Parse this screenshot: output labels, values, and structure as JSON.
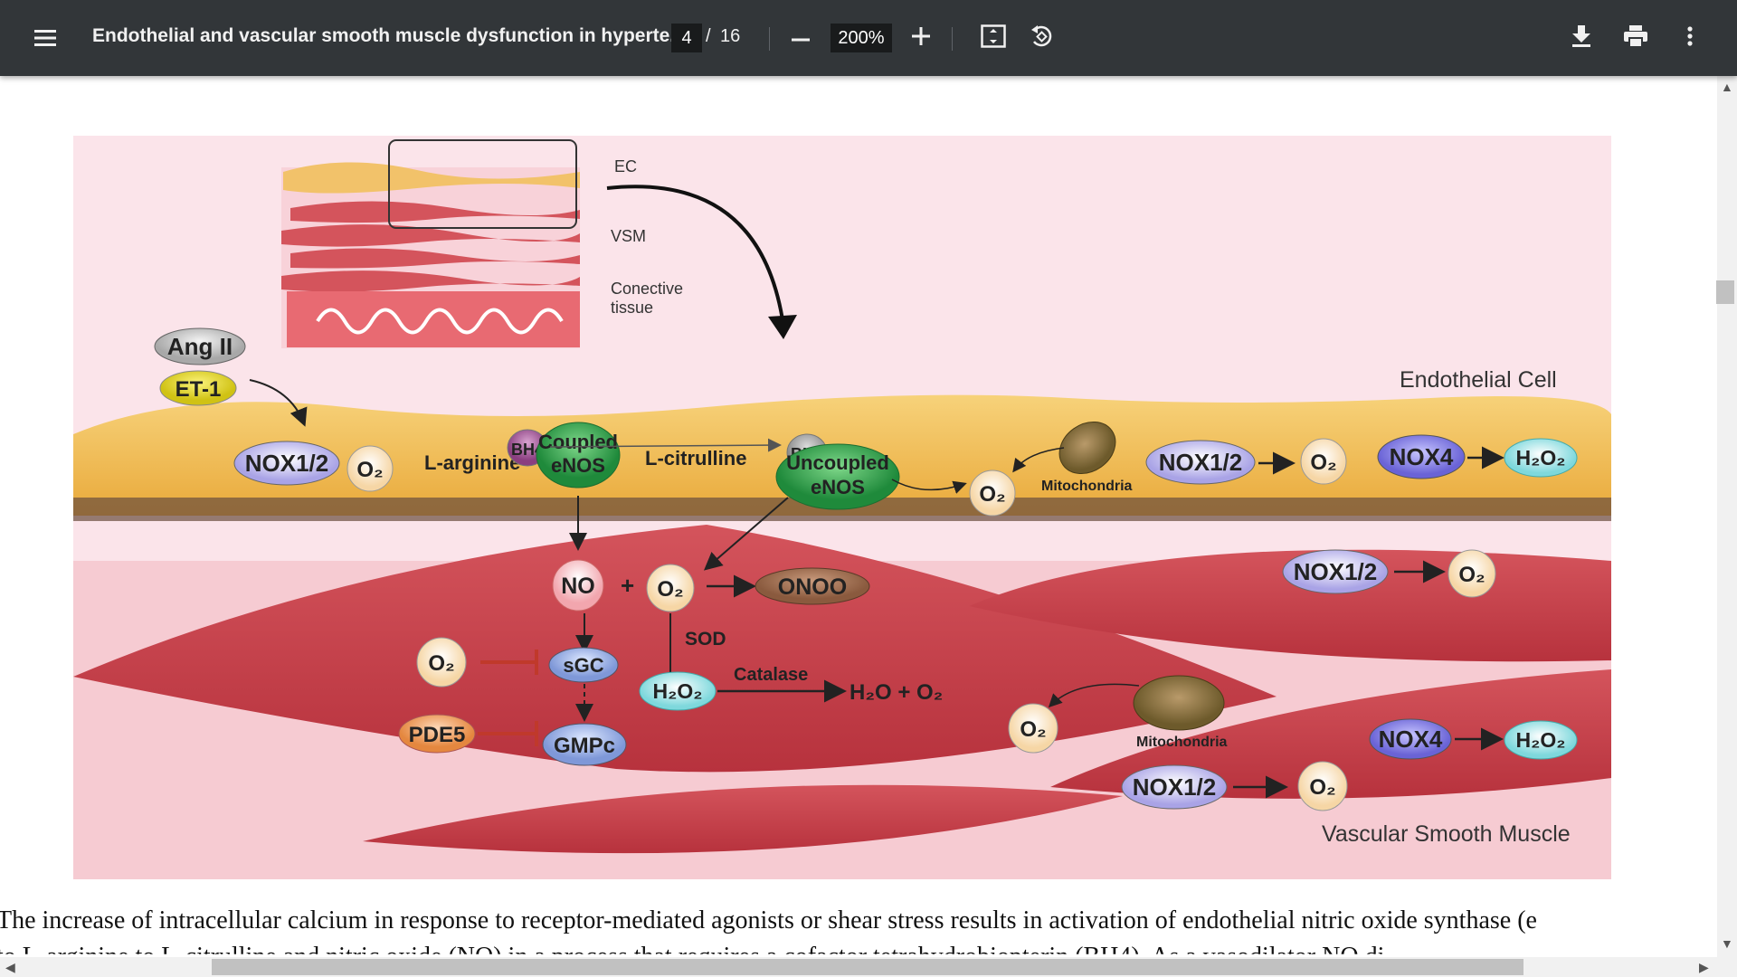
{
  "toolbar": {
    "menu_icon": "menu-icon",
    "title": "Endothelial and vascular smooth muscle dysfunction in hyperte...",
    "current_page": "4",
    "page_separator": "/",
    "total_pages": "16",
    "zoom": "200%",
    "zoom_out_icon": "minus-icon",
    "zoom_in_icon": "plus-icon",
    "fit_page_icon": "fit-page-icon",
    "rotate_icon": "rotate-icon",
    "download_icon": "download-icon",
    "print_icon": "print-icon",
    "more_icon": "more-vert-icon"
  },
  "document": {
    "paragraph_line1": "The increase of intracellular calcium in response to receptor-mediated agonists or shear stress results in activation of endothelial nitric oxide synthase (e",
    "paragraph_line2": "to L-arginine to L-citrulline and nitric oxide (NO) in a process that requires a cofactor tetrahydrobiopterin (BH4). As a vasodilator NO di"
  },
  "figure": {
    "labels": {
      "ec": "EC",
      "vsm": "VSM",
      "connective": "Conective",
      "tissue": "tissue",
      "endothelial_cell": "Endothelial Cell",
      "vascular_smooth_muscle": "Vascular Smooth Muscle",
      "ang2": "Ang II",
      "et1": "ET-1",
      "bh4": "BH4",
      "bh2": "BH2",
      "nox12": "NOX1/2",
      "nox4": "NOX4",
      "o2": "O₂",
      "h2o2": "H₂O₂",
      "larginine": "L-arginine",
      "lcitrulline": "L-citrulline",
      "coupled": "Coupled",
      "uncoupled": "Uncoupled",
      "enos": "eNOS",
      "mitochondria": "Mitochondria",
      "no": "NO",
      "plus": "+",
      "onoo": "ONOO",
      "sod": "SOD",
      "catalase": "Catalase",
      "h2o_o2": "H₂O + O₂",
      "sgc": "sGC",
      "gmpc": "GMPc",
      "pde5": "PDE5"
    }
  },
  "colors": {
    "toolbar_bg": "#323639",
    "figure_bg": "#fbe4ea",
    "endothelial": "#f2b547",
    "muscle": "#c9414b"
  }
}
